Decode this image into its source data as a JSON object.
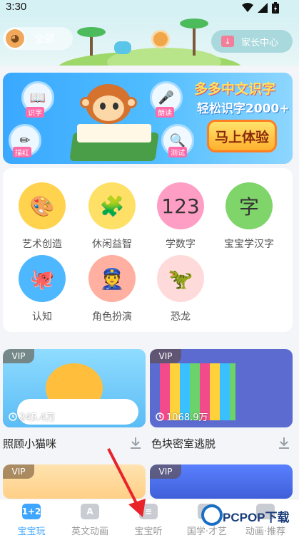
{
  "status_bar": {
    "time": "3:30"
  },
  "header": {
    "profile_label": "全部",
    "parent_center_label": "家长中心"
  },
  "banner": {
    "title": "多多中文识字",
    "subtitle": "轻松识字2000+",
    "cta_label": "马上体验",
    "bubbles": [
      "识字",
      "朗读",
      "描红",
      "测试"
    ]
  },
  "categories": [
    {
      "label": "艺术创造",
      "icon": "art-icon",
      "color": "#ffd34d"
    },
    {
      "label": "休闲益智",
      "icon": "puzzle-icon",
      "color": "#ffe066"
    },
    {
      "label": "学数字",
      "icon": "number-icon",
      "color": "#ff9ec4"
    },
    {
      "label": "宝宝学汉字",
      "icon": "hanzi-icon",
      "color": "#7fd46a"
    },
    {
      "label": "认知",
      "icon": "cognition-icon",
      "color": "#4db8ff"
    },
    {
      "label": "角色扮演",
      "icon": "roleplay-icon",
      "color": "#ffb0a0"
    },
    {
      "label": "恐龙",
      "icon": "dinosaur-icon",
      "color": "#ffdada"
    }
  ],
  "games": [
    {
      "title": "照顾小猫咪",
      "plays": "245.4万",
      "badge": "VIP",
      "color": "#7ed0ff"
    },
    {
      "title": "色块密室逃脱",
      "plays": "1068.9万",
      "badge": "VIP",
      "color": "#5b6bd0"
    },
    {
      "title": "",
      "plays": "",
      "badge": "VIP",
      "color": "#ffd9a0"
    },
    {
      "title": "",
      "plays": "",
      "badge": "VIP",
      "color": "#4a6fe0"
    }
  ],
  "nav": [
    {
      "label": "宝宝玩",
      "icon_text": "1+2",
      "active": true
    },
    {
      "label": "英文动画",
      "icon_text": "A",
      "active": false
    },
    {
      "label": "宝宝听",
      "icon_text": "≡",
      "active": false
    },
    {
      "label": "国学·才艺",
      "icon_text": "",
      "active": false
    },
    {
      "label": "动画·推荐",
      "icon_text": "",
      "active": false
    }
  ],
  "watermark": {
    "text": "PCPOP下载"
  },
  "colors": {
    "accent": "#3fa6ff",
    "arrow": "#e8232a",
    "cta": "#ffb02e"
  }
}
